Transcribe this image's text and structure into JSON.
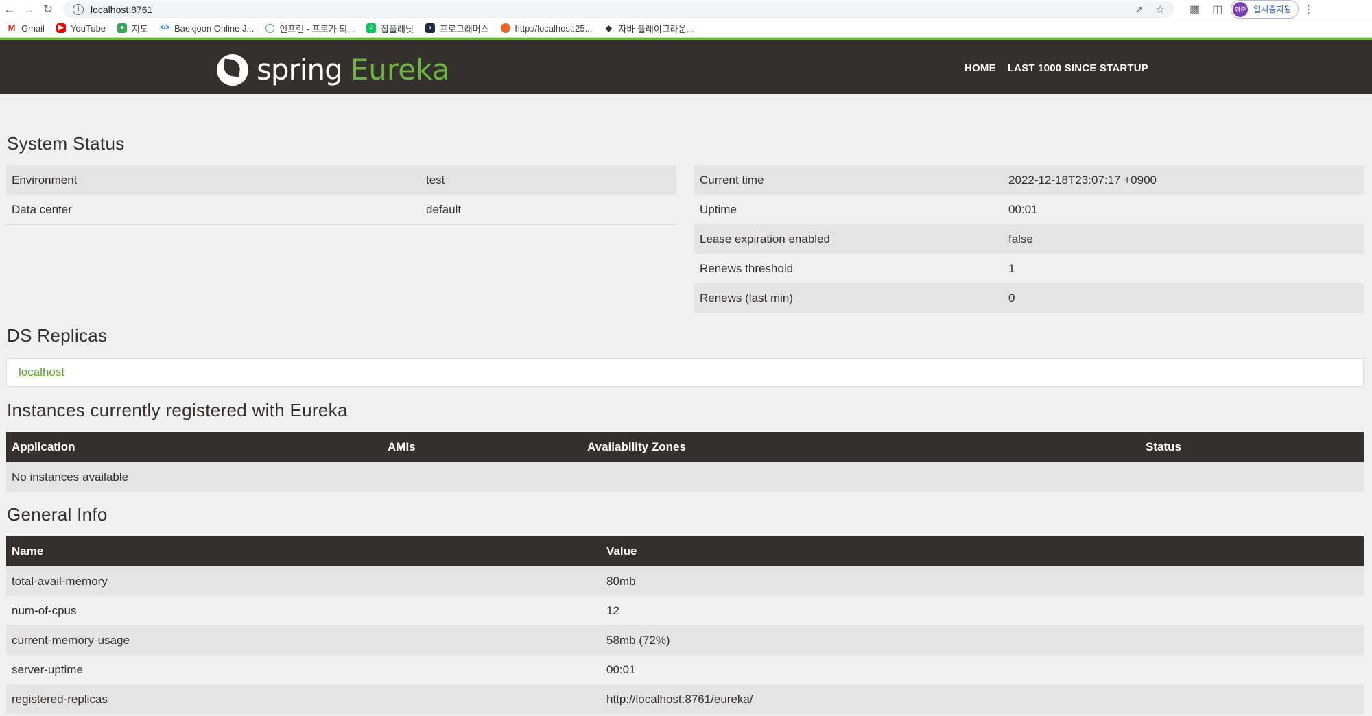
{
  "browser": {
    "url": "localhost:8761",
    "profile_label": "일시중지됨",
    "profile_initials": "영준",
    "bookmarks": [
      {
        "label": "Gmail",
        "icon": "gmail-icon"
      },
      {
        "label": "YouTube",
        "icon": "youtube-icon"
      },
      {
        "label": "지도",
        "icon": "maps-icon"
      },
      {
        "label": "Baekjoon Online J...",
        "icon": "code-icon"
      },
      {
        "label": "인프런 - 프로가 되...",
        "icon": "inflearn-icon"
      },
      {
        "label": "잡플래닛",
        "icon": "jobplanet-icon"
      },
      {
        "label": "프로그래머스",
        "icon": "programmers-icon"
      },
      {
        "label": "http://localhost:25...",
        "icon": "localhost-icon"
      },
      {
        "label": "자바 플레이그라운...",
        "icon": "java-icon"
      }
    ]
  },
  "header": {
    "brand_spring": "spring",
    "brand_eureka": "Eureka",
    "nav": [
      "HOME",
      "LAST 1000 SINCE STARTUP"
    ]
  },
  "system_status": {
    "title": "System Status",
    "left": [
      {
        "key": "Environment",
        "value": "test"
      },
      {
        "key": "Data center",
        "value": "default"
      }
    ],
    "right": [
      {
        "key": "Current time",
        "value": "2022-12-18T23:07:17 +0900"
      },
      {
        "key": "Uptime",
        "value": "00:01"
      },
      {
        "key": "Lease expiration enabled",
        "value": "false"
      },
      {
        "key": "Renews threshold",
        "value": "1"
      },
      {
        "key": "Renews (last min)",
        "value": "0"
      }
    ]
  },
  "ds_replicas": {
    "title": "DS Replicas",
    "link": "localhost"
  },
  "instances": {
    "title": "Instances currently registered with Eureka",
    "columns": [
      "Application",
      "AMIs",
      "Availability Zones",
      "Status"
    ],
    "empty_text": "No instances available"
  },
  "general_info": {
    "title": "General Info",
    "columns": [
      "Name",
      "Value"
    ],
    "rows": [
      {
        "name": "total-avail-memory",
        "value": "80mb"
      },
      {
        "name": "num-of-cpus",
        "value": "12"
      },
      {
        "name": "current-memory-usage",
        "value": "58mb (72%)"
      },
      {
        "name": "server-uptime",
        "value": "00:01"
      },
      {
        "name": "registered-replicas",
        "value": "http://localhost:8761/eureka/"
      }
    ]
  },
  "colors": {
    "accent": "#6db33f",
    "nav_bg": "#34302d",
    "page_bg": "#f0f0f0"
  }
}
